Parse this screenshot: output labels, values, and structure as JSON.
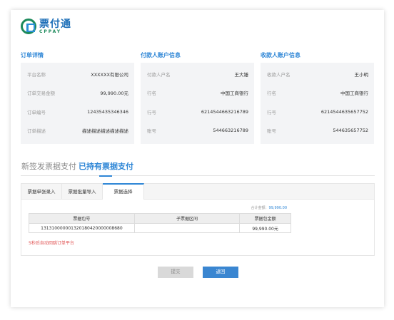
{
  "logo": {
    "cn": "票付通",
    "en": "CPPAY"
  },
  "sections": {
    "order": {
      "title": "订单详情",
      "rows": [
        {
          "label": "平台名称",
          "value": "XXXXXX有限公司"
        },
        {
          "label": "订单交易金额",
          "value": "99,990.00元"
        },
        {
          "label": "订单编号",
          "value": "12435435346346"
        },
        {
          "label": "订单描述",
          "value": "描述描述描述描述描述"
        }
      ]
    },
    "payer": {
      "title": "付款人账户信息",
      "rows": [
        {
          "label": "付款人户名",
          "value": "王大锤"
        },
        {
          "label": "行名",
          "value": "中国工商银行"
        },
        {
          "label": "行号",
          "value": "6214544663216789"
        },
        {
          "label": "账号",
          "value": "544663216789"
        }
      ]
    },
    "payee": {
      "title": "收款人账户信息",
      "rows": [
        {
          "label": "收款人户名",
          "value": "王小明"
        },
        {
          "label": "行名",
          "value": "中国工商银行"
        },
        {
          "label": "行号",
          "value": "6214544635657752"
        },
        {
          "label": "账号",
          "value": "544635657752"
        }
      ]
    }
  },
  "main_tabs": {
    "new": "新签发票据支付",
    "existing": "已持有票据支付"
  },
  "sub_tabs": [
    "票据单张录入",
    "票据批量导入",
    "票据选择"
  ],
  "summary": {
    "label": "合计金额：",
    "value": "99,990.00"
  },
  "table": {
    "headers": [
      "票据包号",
      "子票据区间",
      "票据包金额"
    ],
    "rows": [
      [
        "131310000001320180420000008680",
        "",
        "99,990.00元"
      ]
    ]
  },
  "hint": "5秒后自动回跳订单平台",
  "buttons": {
    "submit": "提交",
    "back": "返回"
  }
}
